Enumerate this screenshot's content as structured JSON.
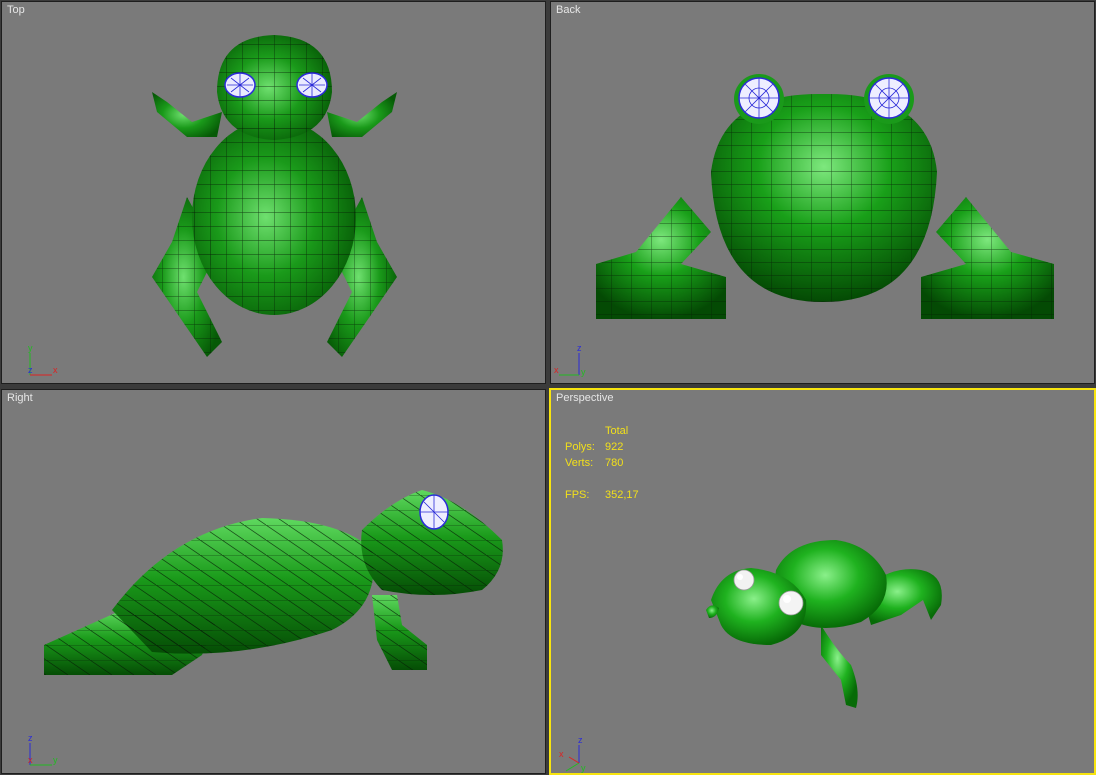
{
  "viewports": {
    "top": {
      "label": "Top",
      "axis": {
        "up": "y",
        "right": "x",
        "center": "z"
      }
    },
    "back": {
      "label": "Back",
      "axis": {
        "up": "z",
        "right": "y",
        "center": "x"
      }
    },
    "right": {
      "label": "Right",
      "axis": {
        "up": "z",
        "right": "y",
        "center": "x"
      }
    },
    "perspective": {
      "label": "Perspective",
      "axis": {
        "up": "z",
        "right": "x",
        "center": "y"
      },
      "stats": {
        "header": "Total",
        "polys_label": "Polys:",
        "polys_value": "922",
        "verts_label": "Verts:",
        "verts_value": "780",
        "fps_label": "FPS:",
        "fps_value": "352,17"
      }
    }
  },
  "colors": {
    "viewport_bg": "#7a7a7a",
    "active_border": "#f7e40f",
    "model_green": "#1fa51f",
    "wire": "#0a1a0a",
    "eye_blue": "#2b2bd8",
    "stats_text": "#f2e01a"
  }
}
